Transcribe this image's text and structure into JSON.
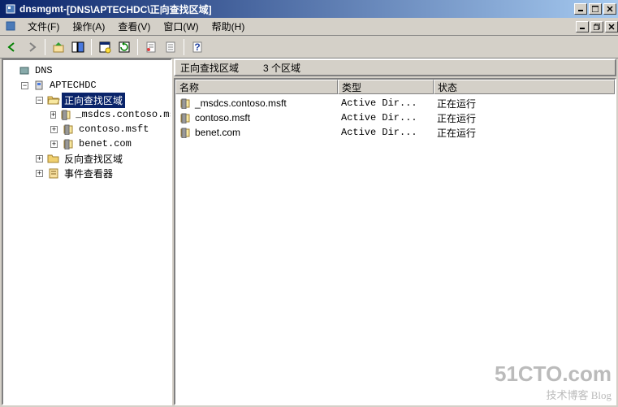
{
  "titlebar": {
    "app": "dnsmgmt",
    "sep": " - ",
    "doc": "[DNS\\APTECHDC\\正向查找区域]"
  },
  "menu": {
    "file": "文件(F)",
    "action": "操作(A)",
    "view": "查看(V)",
    "window": "窗口(W)",
    "help": "帮助(H)"
  },
  "header": {
    "title": "正向查找区域",
    "count": "3 个区域"
  },
  "columns": {
    "name": "名称",
    "type": "类型",
    "status": "状态"
  },
  "tree": {
    "root": "DNS",
    "server": "APTECHDC",
    "fwd": "正向查找区域",
    "rev": "反向查找区域",
    "ev": "事件查看器",
    "z1": "_msdcs.contoso.msft",
    "z2": "contoso.msft",
    "z3": "benet.com"
  },
  "list": [
    {
      "name": "_msdcs.contoso.msft",
      "type": "Active Dir...",
      "status": "正在运行"
    },
    {
      "name": "contoso.msft",
      "type": "Active Dir...",
      "status": "正在运行"
    },
    {
      "name": "benet.com",
      "type": "Active Dir...",
      "status": "正在运行"
    }
  ],
  "watermark": {
    "big": "51CTO.com",
    "small": "技术博客  Blog"
  }
}
